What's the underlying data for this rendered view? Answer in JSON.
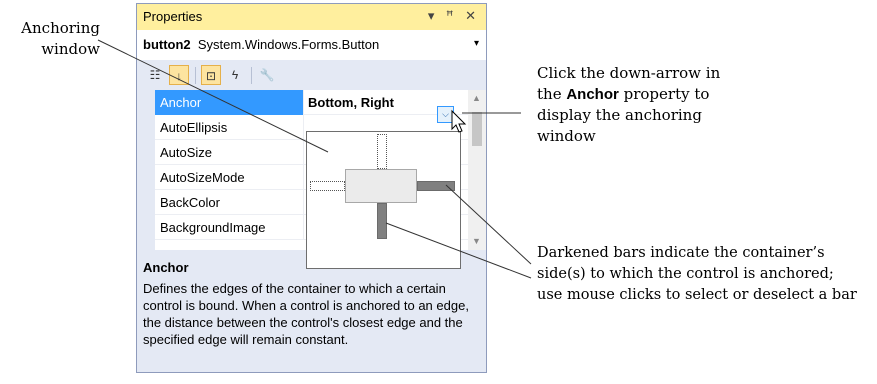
{
  "callouts": {
    "anchoring": [
      "Anchoring",
      "window"
    ],
    "click": {
      "line1": "Click the down-arrow in",
      "pre": "the ",
      "keyword": "Anchor",
      "post": " property to",
      "line3": "display the anchoring",
      "line4": "window"
    },
    "darkened": [
      "Darkened bars indicate the container’s",
      "side(s) to which the control is anchored;",
      "use mouse clicks to select or deselect a bar"
    ]
  },
  "window": {
    "title": "Properties",
    "controls": {
      "dropdown": "▾",
      "pin": "ꟸ",
      "close": "✕"
    },
    "object": {
      "name": "button2",
      "type": "System.Windows.Forms.Button",
      "arrow": "▾"
    },
    "toolbar": [
      {
        "icon": "categorized-icon",
        "glyph": "☷",
        "active": false
      },
      {
        "icon": "alphabetical-icon",
        "glyph": "↓",
        "active": true
      },
      {
        "icon": "properties-icon",
        "glyph": "⊡",
        "active": true
      },
      {
        "icon": "events-icon",
        "glyph": "ϟ",
        "active": false
      },
      {
        "icon": "property-pages-icon",
        "glyph": "🔧",
        "active": false
      }
    ]
  },
  "grid": {
    "rows": [
      {
        "name": "Anchor",
        "value": "Bottom, Right",
        "selected": true
      },
      {
        "name": "AutoEllipsis",
        "value": ""
      },
      {
        "name": "AutoSize",
        "value": ""
      },
      {
        "name": "AutoSizeMode",
        "value": ""
      },
      {
        "name": "BackColor",
        "value": ""
      },
      {
        "name": "BackgroundImage",
        "value": ""
      }
    ],
    "dropdown_glyph": "⌵",
    "scroll": {
      "up": "▲",
      "down": "▼"
    }
  },
  "anchor_editor": {
    "top": false,
    "left": false,
    "right": true,
    "bottom": true
  },
  "description": {
    "title": "Anchor",
    "text": "Defines the edges of the container to which a certain control is bound. When a control is anchored to an edge, the distance between the control's closest edge and the specified edge will remain constant."
  },
  "colors": {
    "selection": "#3399ff",
    "titlebar": "#ffef9e",
    "anchored_bar": "#808080"
  }
}
